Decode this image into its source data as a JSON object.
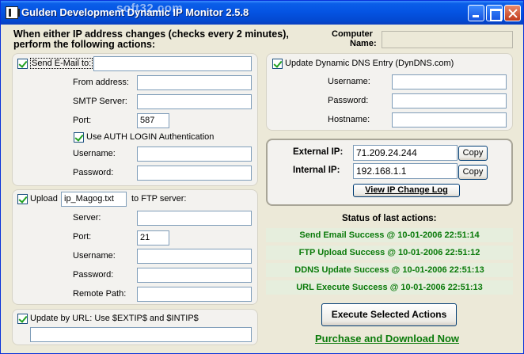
{
  "window": {
    "title": "Gulden Development Dynamic IP Monitor 2.5.8",
    "watermark": "soft32.com"
  },
  "header": {
    "line1": "When either IP address changes (checks every 2 minutes),",
    "line2": "perform the following actions:",
    "computer_label_1": "Computer",
    "computer_label_2": "Name:",
    "computer_value": ""
  },
  "email": {
    "checkbox_label": "Send E-Mail to:",
    "to_value": "",
    "from_label": "From address:",
    "from_value": "",
    "smtp_label": "SMTP Server:",
    "smtp_value": "",
    "port_label": "Port:",
    "port_value": "587",
    "auth_label": "Use AUTH LOGIN Authentication",
    "username_label": "Username:",
    "username_value": "",
    "password_label": "Password:",
    "password_value": ""
  },
  "ftp": {
    "upload_label": "Upload",
    "file_value": "ip_Magog.txt",
    "to_label": "to FTP server:",
    "server_label": "Server:",
    "server_value": "",
    "port_label": "Port:",
    "port_value": "21",
    "username_label": "Username:",
    "username_value": "",
    "password_label": "Password:",
    "password_value": "",
    "remote_label": "Remote Path:",
    "remote_value": ""
  },
  "url": {
    "checkbox_label": "Update by URL: Use $EXTIP$ and $INTIP$",
    "url_value": ""
  },
  "dns": {
    "checkbox_label": "Update Dynamic DNS Entry (DynDNS.com)",
    "username_label": "Username:",
    "username_value": "",
    "password_label": "Password:",
    "password_value": "",
    "hostname_label": "Hostname:",
    "hostname_value": ""
  },
  "ip": {
    "external_label": "External IP:",
    "external_value": "71.209.24.244",
    "internal_label": "Internal IP:",
    "internal_value": "192.168.1.1",
    "copy_label": "Copy",
    "log_label": "View IP Change Log"
  },
  "status": {
    "title": "Status of last actions:",
    "items": [
      "Send Email Success @ 10-01-2006 22:51:14",
      "FTP Upload Success @ 10-01-2006 22:51:12",
      "DDNS Update Success @ 10-01-2006 22:51:13",
      "URL Execute Success @ 10-01-2006 22:51:13"
    ]
  },
  "actions": {
    "execute_label": "Execute Selected Actions",
    "purchase_label": "Purchase and Download Now"
  },
  "colors": {
    "title_blue": "#0554e3",
    "status_green": "#0a7a0a",
    "status_bg": "#e6eedd",
    "window_bg": "#ece9d8"
  }
}
